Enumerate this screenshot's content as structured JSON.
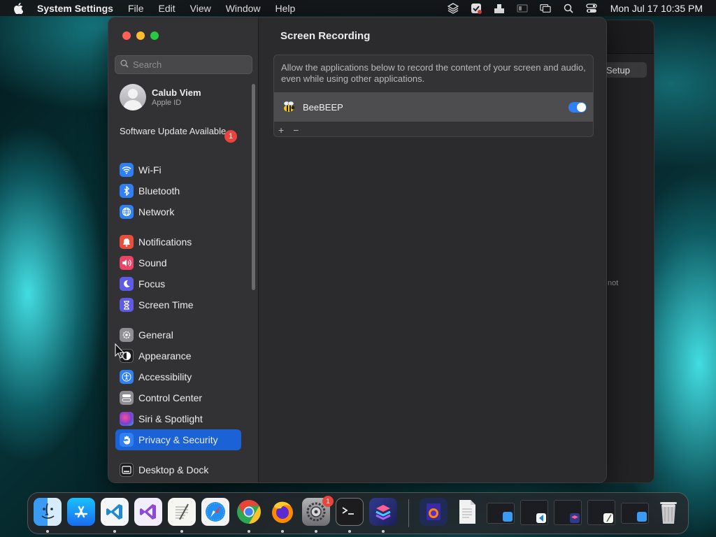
{
  "menubar": {
    "app_name": "System Settings",
    "menus": [
      "File",
      "Edit",
      "View",
      "Window",
      "Help"
    ],
    "clock": "Mon Jul 17  10:35 PM"
  },
  "background_window": {
    "button_label": "Setup",
    "partial_text": "not"
  },
  "sidebar": {
    "search_placeholder": "Search",
    "account": {
      "name": "Calub Viem",
      "subtitle": "Apple ID"
    },
    "update": {
      "label": "Software Update Available",
      "badge": "1"
    },
    "items": [
      {
        "label": "Wi-Fi",
        "icon": "wifi-icon",
        "color": "#2f7ff5"
      },
      {
        "label": "Bluetooth",
        "icon": "bluetooth-icon",
        "color": "#2f7ff5"
      },
      {
        "label": "Network",
        "icon": "globe-icon",
        "color": "#2f7ff5"
      },
      {
        "label": "Notifications",
        "icon": "bell-icon",
        "color": "#eb4d3d"
      },
      {
        "label": "Sound",
        "icon": "speaker-icon",
        "color": "#eb4466"
      },
      {
        "label": "Focus",
        "icon": "moon-icon",
        "color": "#5e5ce6"
      },
      {
        "label": "Screen Time",
        "icon": "hourglass-icon",
        "color": "#5e5ce6"
      },
      {
        "label": "General",
        "icon": "gear-icon",
        "color": "#8e8e93"
      },
      {
        "label": "Appearance",
        "icon": "appearance-icon",
        "color": "#1c1c1e"
      },
      {
        "label": "Accessibility",
        "icon": "accessibility-icon",
        "color": "#2f7ff5"
      },
      {
        "label": "Control Center",
        "icon": "control-center-icon",
        "color": "#8e8e93"
      },
      {
        "label": "Siri & Spotlight",
        "icon": "siri-icon",
        "color": "#7a3fd1"
      },
      {
        "label": "Privacy & Security",
        "icon": "hand-icon",
        "color": "#2f7ff5",
        "selected": true
      },
      {
        "label": "Desktop & Dock",
        "icon": "dock-icon",
        "color": "#1c1c1e"
      }
    ]
  },
  "content": {
    "title": "Screen Recording",
    "description": "Allow the applications below to record the content of your screen and audio, even while using other applications.",
    "apps": [
      {
        "name": "BeeBEEP",
        "enabled": true
      }
    ],
    "footer": {
      "add": "+",
      "remove": "−"
    }
  },
  "dock": {
    "items": [
      "Finder",
      "App Store",
      "Visual Studio Code",
      "Visual Studio",
      "TextEdit",
      "Safari",
      "Google Chrome",
      "Firefox",
      "System Settings",
      "Terminal",
      "Shortcuts"
    ],
    "system_settings_badge": "1",
    "recent": [
      "Firefox Document",
      "Document",
      "Window 1",
      "Window 2",
      "Window 3",
      "Window 4",
      "Window 5"
    ],
    "trash": "Trash"
  }
}
